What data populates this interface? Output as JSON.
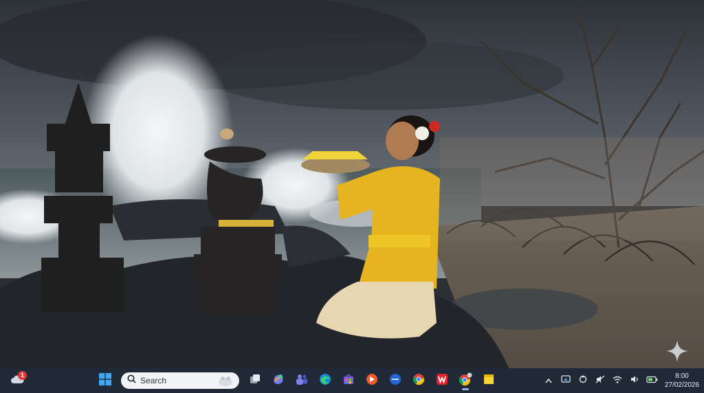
{
  "taskbar": {
    "widgets": {
      "icon": "weather-cloud-icon",
      "badge": "1"
    },
    "search": {
      "placeholder": "Search"
    },
    "apps": [
      {
        "name": "start-button",
        "icon": "windows-logo-icon"
      },
      {
        "name": "task-view",
        "icon": "task-view-icon"
      },
      {
        "name": "copilot",
        "icon": "copilot-icon"
      },
      {
        "name": "teams",
        "icon": "teams-icon"
      },
      {
        "name": "edge",
        "icon": "edge-icon"
      },
      {
        "name": "store",
        "icon": "store-icon"
      },
      {
        "name": "app-orange",
        "icon": "orange-app-icon"
      },
      {
        "name": "app-blue",
        "icon": "blue-app-icon"
      },
      {
        "name": "chrome",
        "icon": "chrome-icon"
      },
      {
        "name": "wps-office",
        "icon": "wps-icon"
      },
      {
        "name": "chrome-profile",
        "icon": "chrome-icon"
      },
      {
        "name": "sticky-notes",
        "icon": "sticky-notes-icon"
      }
    ],
    "tray": [
      "chevron-up-icon",
      "screen-icon",
      "ring-icon",
      "mute-icon",
      "wifi-icon",
      "volume-icon",
      "battery-icon"
    ],
    "clock": {
      "time": "8:00",
      "date": "27/02/2026"
    }
  },
  "colors": {
    "taskbar": "#1f2a36",
    "accent": "#e53935"
  }
}
